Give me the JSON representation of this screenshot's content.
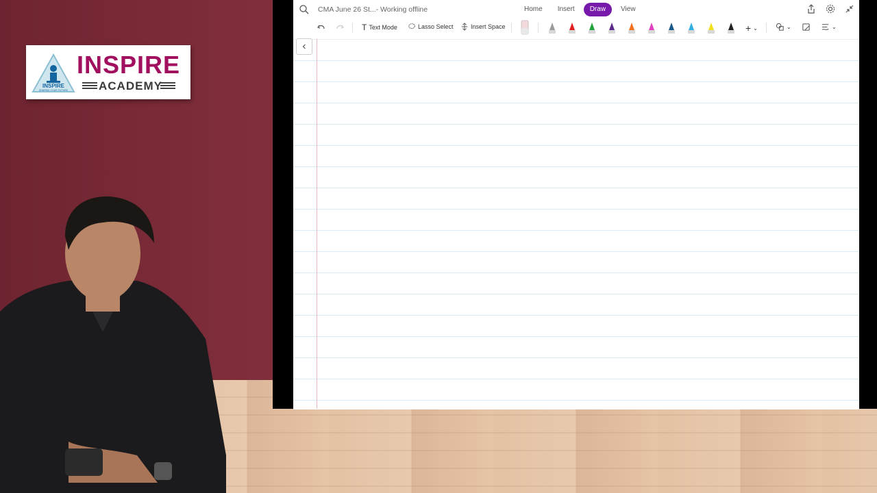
{
  "logo": {
    "brand": "INSPIRE",
    "sub": "ACADEMY",
    "tagline": "SHAPING YOUR FUTURE",
    "mark": "INSPIRE"
  },
  "app": {
    "title": "CMA June 26 St...- Working offline",
    "tabs": [
      {
        "label": "Home"
      },
      {
        "label": "Insert"
      },
      {
        "label": "Draw"
      },
      {
        "label": "View"
      }
    ],
    "toolbar": {
      "text_mode": "Text Mode",
      "lasso_select": "Lasso Select",
      "insert_space": "Insert Space"
    },
    "pen_colors": [
      "#9a9a9a",
      "#e02020",
      "#22a23a",
      "#5a2b8a",
      "#f07020",
      "#e040c0",
      "#1a5a8a",
      "#30b0e0",
      "#f0e020",
      "#222222"
    ],
    "accent": "#7719aa"
  }
}
